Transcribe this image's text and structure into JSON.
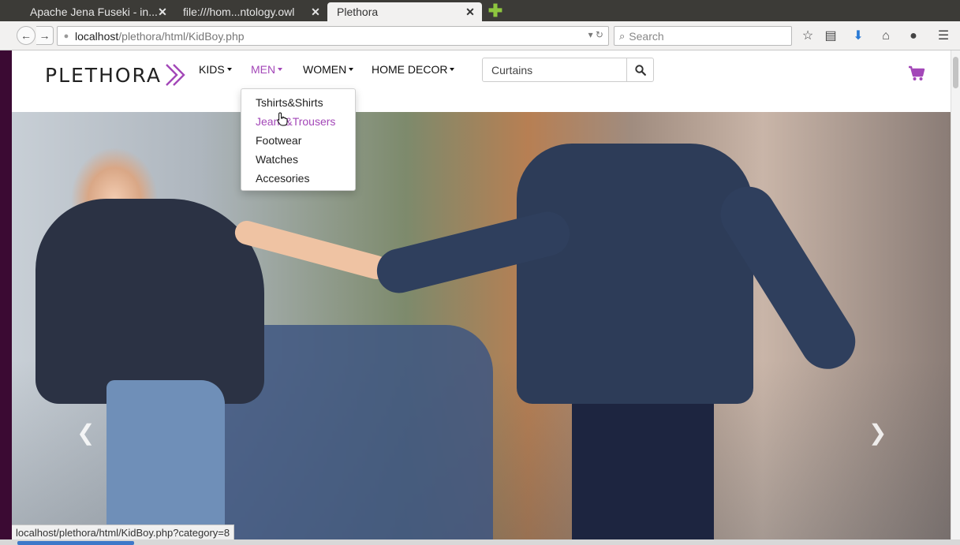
{
  "browser": {
    "tabs": [
      {
        "label": "Apache Jena Fuseki - in...",
        "active": false
      },
      {
        "label": "file:///hom...ntology.owl",
        "active": false
      },
      {
        "label": "Plethora",
        "active": true
      }
    ],
    "url_host": "localhost",
    "url_path": "/plethora/html/KidBoy.php",
    "search_placeholder": "Search",
    "status_url": "localhost/plethora/html/KidBoy.php?category=8"
  },
  "site": {
    "logo_text": "PLETHORA",
    "brand_color": "#a347b8",
    "nav": {
      "kids": "KIDS",
      "men": "MEN",
      "women": "WOMEN",
      "home_decor": "HOME DECOR"
    },
    "search_value": "Curtains",
    "men_menu": [
      "Tshirts&Shirts",
      "Jeans&Trousers",
      "Footwear",
      "Watches",
      "Accesories"
    ]
  },
  "icons": [
    "back-icon",
    "forward-icon",
    "reload-icon",
    "bookmark-star-icon",
    "reading-list-icon",
    "download-icon",
    "home-icon",
    "chat-icon",
    "menu-icon",
    "search-icon",
    "cart-icon",
    "chevron-left-icon",
    "chevron-right-icon"
  ]
}
